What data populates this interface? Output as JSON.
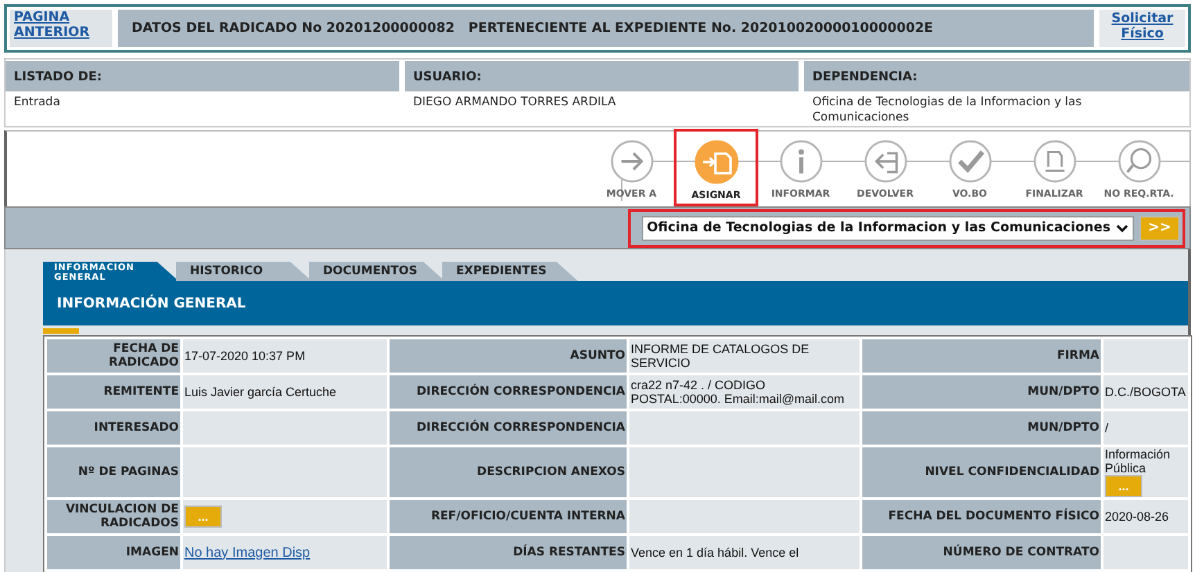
{
  "header": {
    "back_link": "PAGINA ANTERIOR",
    "title": "DATOS DEL RADICADO No 20201200000082   PERTENECIENTE AL EXPEDIENTE No. 20201002000010000002E",
    "request_link": "Solicitar Físico"
  },
  "listing": [
    {
      "label": "LISTADO DE:",
      "value": "Entrada"
    },
    {
      "label": "USUARIO:",
      "value": "DIEGO ARMANDO TORRES ARDILA"
    },
    {
      "label": "DEPENDENCIA:",
      "value": " Oficina de Tecnologias de la Informacion y las Comunicaciones"
    }
  ],
  "actions": [
    {
      "label": "MOVER A",
      "kind": "arrow",
      "selected": false,
      "highlighted": false
    },
    {
      "label": "ASIGNAR",
      "kind": "assign",
      "selected": true,
      "highlighted": true
    },
    {
      "label": "INFORMAR",
      "kind": "info",
      "selected": false,
      "highlighted": false
    },
    {
      "label": "DEVOLVER",
      "kind": "return",
      "selected": false,
      "highlighted": false
    },
    {
      "label": "VO.BO",
      "kind": "check",
      "selected": false,
      "highlighted": false
    },
    {
      "label": "FINALIZAR",
      "kind": "finalize",
      "selected": false,
      "highlighted": false
    },
    {
      "label": "NO REQ.RTA.",
      "kind": "noreply",
      "selected": false,
      "highlighted": false
    }
  ],
  "destination": {
    "value": "Oficina de Tecnologias de la Informacion y las Comunicaciones",
    "button": ">>",
    "highlighted": true
  },
  "tabs": [
    {
      "label": "INFORMACION GENERAL",
      "selected": true
    },
    {
      "label": "HISTORICO",
      "selected": false
    },
    {
      "label": "DOCUMENTOS",
      "selected": false
    },
    {
      "label": "EXPEDIENTES",
      "selected": false
    }
  ],
  "section_title": "INFORMACIÓN GENERAL",
  "rows": [
    [
      {
        "label": "FECHA DE RADICADO",
        "kind": "text",
        "value": "17-07-2020 10:37 PM"
      },
      {
        "label": "ASUNTO",
        "kind": "text",
        "value": "INFORME DE CATALOGOS DE SERVICIO"
      },
      {
        "label": "FIRMA",
        "kind": "empty"
      }
    ],
    [
      {
        "label": "REMITENTE",
        "kind": "text",
        "value": "Luis Javier garcía Certuche"
      },
      {
        "label": "DIRECCIÓN CORRESPONDENCIA",
        "kind": "text",
        "value": "cra22 n7-42 . / CODIGO POSTAL:00000. Email:mail@mail.com"
      },
      {
        "label": "MUN/DPTO",
        "kind": "text",
        "value": "D.C./BOGOTA"
      }
    ],
    [
      {
        "label": "INTERESADO",
        "kind": "empty"
      },
      {
        "label": "DIRECCIÓN CORRESPONDENCIA",
        "kind": "empty"
      },
      {
        "label": "MUN/DPTO",
        "kind": "text",
        "value": "/"
      }
    ],
    [
      {
        "label": "Nº DE PAGINAS",
        "kind": "empty"
      },
      {
        "label": "DESCRIPCION ANEXOS",
        "kind": "empty"
      },
      {
        "label": "NIVEL CONFIDENCIALIDAD",
        "kind": "text_button",
        "value": "Información Pública",
        "button": "..."
      }
    ],
    [
      {
        "label": "VINCULACION DE RADICADOS",
        "kind": "button",
        "button": "..."
      },
      {
        "label": "REF/OFICIO/CUENTA INTERNA",
        "kind": "empty"
      },
      {
        "label": "FECHA DEL DOCUMENTO FÍSICO",
        "kind": "text",
        "value": "2020-08-26"
      }
    ],
    [
      {
        "label": "IMAGEN",
        "kind": "link",
        "value": "No hay Imagen Disp"
      },
      {
        "label": "DÍAS RESTANTES",
        "kind": "text",
        "value": "Vence en 1 día hábil. Vence el"
      },
      {
        "label": "NÚMERO DE CONTRATO",
        "kind": "empty"
      }
    ]
  ]
}
